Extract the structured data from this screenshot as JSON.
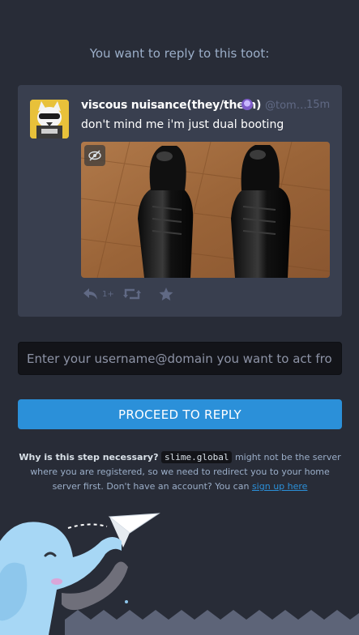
{
  "heading": "You want to reply to this toot:",
  "toot": {
    "display_name": "viscous nuisance(they/them)",
    "handle": "@tom…",
    "time": "15m",
    "content": "don't mind me i'm just dual booting",
    "emoji_icon": "purple-emoji-icon",
    "actions": {
      "reply_count": "1+",
      "reply_icon": "reply-icon",
      "boost_icon": "boost-icon",
      "favourite_icon": "star-icon"
    }
  },
  "form": {
    "username_placeholder": "Enter your username@domain you want to act from",
    "proceed_label": "PROCEED TO REPLY"
  },
  "hint": {
    "question": "Why is this step necessary?",
    "server": "slime.global",
    "text1": "might not be the server where you are registered, so we need to redirect you to your home server first. Don't have an account? You can",
    "signup_link": "sign up here"
  },
  "colors": {
    "background": "#282c37",
    "card": "#393f4f",
    "accent": "#2b90d9",
    "muted": "#9baec8"
  }
}
